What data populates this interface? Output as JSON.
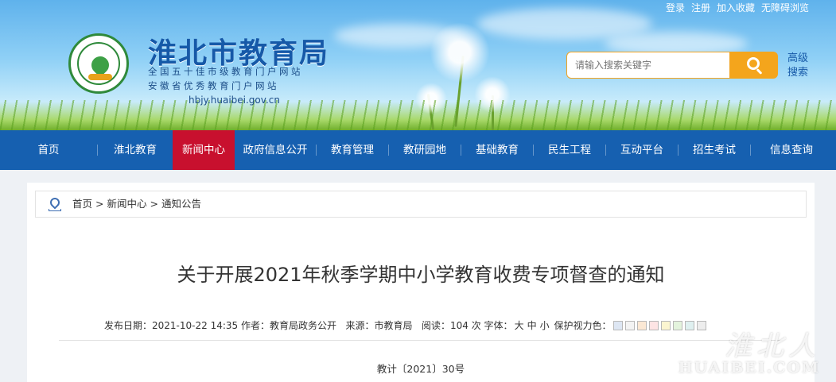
{
  "header": {
    "top_links": [
      "登录",
      "注册",
      "加入收藏",
      "无障碍浏览"
    ],
    "site_title": "淮北市教育局",
    "subtitle1": "全国五十佳市级教育门户网站",
    "subtitle2": "安徽省优秀教育门户网站",
    "url": "hbjy.huaibei.gov.cn",
    "search_placeholder": "请输入搜索关键字",
    "advanced_search": "高级搜索"
  },
  "nav": {
    "items": [
      {
        "label": "首页",
        "active": false
      },
      {
        "label": "淮北教育",
        "active": false
      },
      {
        "label": "新闻中心",
        "active": true
      },
      {
        "label": "政府信息公开",
        "active": false
      },
      {
        "label": "教育管理",
        "active": false
      },
      {
        "label": "教研园地",
        "active": false
      },
      {
        "label": "基础教育",
        "active": false
      },
      {
        "label": "民生工程",
        "active": false
      },
      {
        "label": "互动平台",
        "active": false
      },
      {
        "label": "招生考试",
        "active": false
      },
      {
        "label": "信息查询",
        "active": false
      }
    ]
  },
  "breadcrumb": {
    "items": [
      "首页",
      "新闻中心",
      "通知公告"
    ],
    "separator": ">"
  },
  "article": {
    "title": "关于开展2021年秋季学期中小学教育收费专项督查的通知",
    "meta": {
      "date_label": "发布日期：",
      "date": "2021-10-22 14:35",
      "author_label": "作者：",
      "author": "教育局政务公开",
      "source_label": "来源：",
      "source": "市教育局",
      "views_label": "阅读：",
      "views": "104",
      "views_unit": "次",
      "font_label": "字体：",
      "font_sizes": [
        "大",
        "中",
        "小"
      ],
      "eye_color_label": "保护视力色："
    },
    "eye_colors": [
      "#dde6f3",
      "#f3f3f3",
      "#fbe8d4",
      "#fde4e4",
      "#fbf5d0",
      "#e3f3dd",
      "#dff0f0",
      "#ededed"
    ],
    "doc_number": "教计〔2021〕30号"
  },
  "watermark": {
    "cn": "淮北人",
    "en": "HUAIBEI.COM"
  }
}
